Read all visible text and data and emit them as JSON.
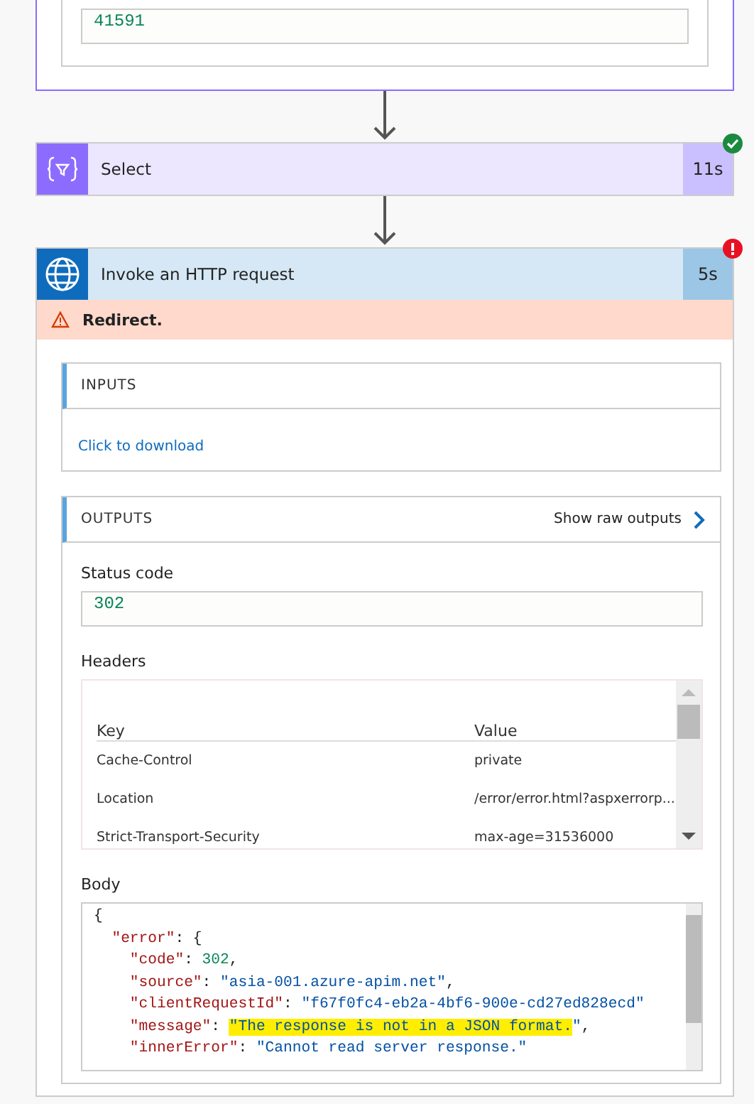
{
  "previous_step": {
    "value": "41591"
  },
  "steps": [
    {
      "title": "Select",
      "duration": "11s",
      "kind": "select",
      "failed": false
    },
    {
      "title": "Invoke an HTTP request",
      "duration": "5s",
      "kind": "http",
      "failed": true,
      "message": "Redirect.",
      "inputs": {
        "heading": "INPUTS",
        "link": "Click to download"
      },
      "outputs": {
        "heading": "OUTPUTS",
        "raw_link": "Show raw outputs",
        "status_label": "Status code",
        "status_value": "302",
        "headers_label": "Headers",
        "headers_columns": [
          "Key",
          "Value"
        ],
        "headers_rows": [
          [
            "Cache-Control",
            "private"
          ],
          [
            "Location",
            "/error/error.html?aspxerrorp..."
          ],
          [
            "Strict-Transport-Security",
            "max-age=31536000"
          ]
        ],
        "body_label": "Body",
        "body_lines": [
          [
            {
              "kind": "punct",
              "text": "{"
            }
          ],
          [
            {
              "kind": "key",
              "text": "  \"error\""
            },
            {
              "kind": "punct",
              "text": ": {"
            }
          ],
          [
            {
              "kind": "key",
              "text": "    \"code\""
            },
            {
              "kind": "punct",
              "text": ": "
            },
            {
              "kind": "number",
              "text": "302"
            },
            {
              "kind": "punct",
              "text": ","
            }
          ],
          [
            {
              "kind": "key",
              "text": "    \"source\""
            },
            {
              "kind": "punct",
              "text": ": "
            },
            {
              "kind": "string",
              "text": "\"asia-001.azure-apim.net\""
            },
            {
              "kind": "punct",
              "text": ","
            }
          ],
          [
            {
              "kind": "key",
              "text": "    \"clientRequestId\""
            },
            {
              "kind": "punct",
              "text": ": "
            },
            {
              "kind": "string",
              "text": "\"f67f0fc4-eb2a-4bf6-900e-cd27ed828ecd\""
            }
          ],
          [
            {
              "kind": "key",
              "text": "    \"message\""
            },
            {
              "kind": "punct",
              "text": ": "
            },
            {
              "kind": "string",
              "text": "\"The response is not in a JSON format.",
              "highlighted": true
            },
            {
              "kind": "string",
              "text": "\""
            },
            {
              "kind": "punct",
              "text": ","
            }
          ],
          [
            {
              "kind": "key",
              "text": "    \"innerError\""
            },
            {
              "kind": "punct",
              "text": ": "
            },
            {
              "kind": "string",
              "text": "\"Cannot read server response.\""
            }
          ]
        ]
      }
    }
  ]
}
